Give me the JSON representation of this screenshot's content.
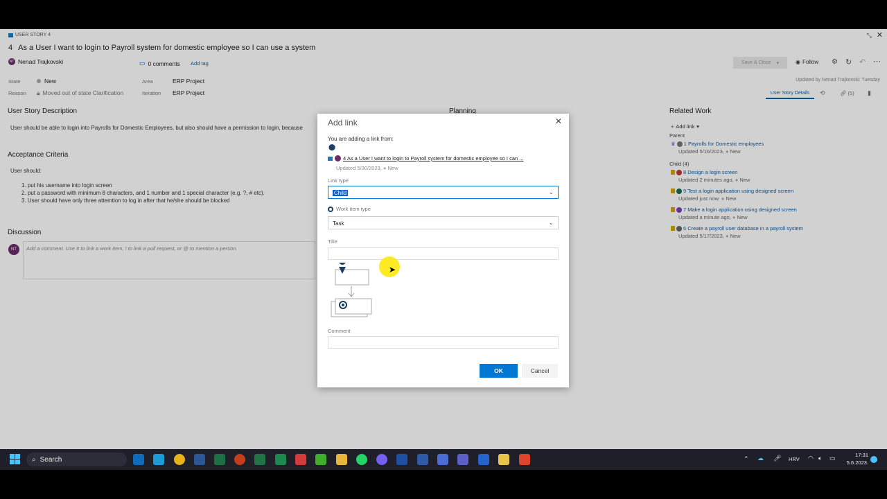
{
  "work_item": {
    "type_label": "USER STORY 4",
    "id": "4",
    "title": "As a User I want to login to Payroll system for domestic employee so I can use a system",
    "assignee": "Nenad Trajkovski",
    "assignee_initials": "NT",
    "comments": "0 comments",
    "add_tag": "Add tag",
    "save_close": "Save & Close",
    "follow": "Follow",
    "updated_by": "Updated by Nenad Trajkovski: Tuesday",
    "state_label": "State",
    "state_value": "New",
    "reason_label": "Reason",
    "reason_value": "Moved out of state Clarification",
    "area_label": "Area",
    "area_value": "ERP Project",
    "iteration_label": "Iteration",
    "iteration_value": "ERP Project",
    "details_tab": "User Story Details",
    "links_count": "(5)"
  },
  "description": {
    "title": "User Story Description",
    "text": "User should be able to login into Payrolls for Domestic Employees, but also should have a permission to login, because"
  },
  "acceptance": {
    "title": "Acceptance Criteria",
    "intro": "User should:",
    "items": [
      "1.  put his username into login screen",
      "2.  put a password with minimum 8 characters, and 1 number and 1 special character (e.g. ?, # etc).",
      "3. User should have only three attemtion to log in after that he/she should be blocked"
    ]
  },
  "discussion": {
    "title": "Discussion",
    "placeholder": "Add a comment. Use # to link a work item, ! to link a pull request, or @ to mention a person."
  },
  "planning": {
    "title": "Planning"
  },
  "related": {
    "title": "Related Work",
    "add_link": "Add link",
    "parent_label": "Parent",
    "parent": {
      "title": "1 Payrolls for Domestic employees",
      "meta": "Updated 5/16/2023,",
      "state": "New"
    },
    "child_label": "Child (4)",
    "children": [
      {
        "title": "8 Design a login screen",
        "meta": "Updated 2 minutes ago,",
        "state": "New",
        "color": "#c0392b"
      },
      {
        "title": "9 Test a login application using designed screen",
        "meta": "Updated just now,",
        "state": "New",
        "color": "#1e6b52"
      },
      {
        "title": "7 Make a login application using designed screen",
        "meta": "Updated a minute ago,",
        "state": "New",
        "color": "#7a3fb5"
      },
      {
        "title": "6 Create a payroll user database in a payroll system",
        "meta": "Updated 5/17/2023,",
        "state": "New",
        "color": "#666666"
      }
    ]
  },
  "dialog": {
    "title": "Add link",
    "adding_from": "You are adding a link from:",
    "source_link": "4 As a User I want to login to Payroll system for domestic employee so I can ...",
    "source_meta": "Updated 5/30/2023,",
    "source_state": "New",
    "link_type_label": "Link type",
    "link_type_value": "Child",
    "work_item_type_label": "Work item type",
    "work_item_type_value": "Task",
    "title_label": "Title",
    "comment_label": "Comment",
    "ok": "OK",
    "cancel": "Cancel"
  },
  "taskbar": {
    "search": "Search",
    "lang": "HRV",
    "time": "17:31",
    "date": "5.6.2023."
  }
}
